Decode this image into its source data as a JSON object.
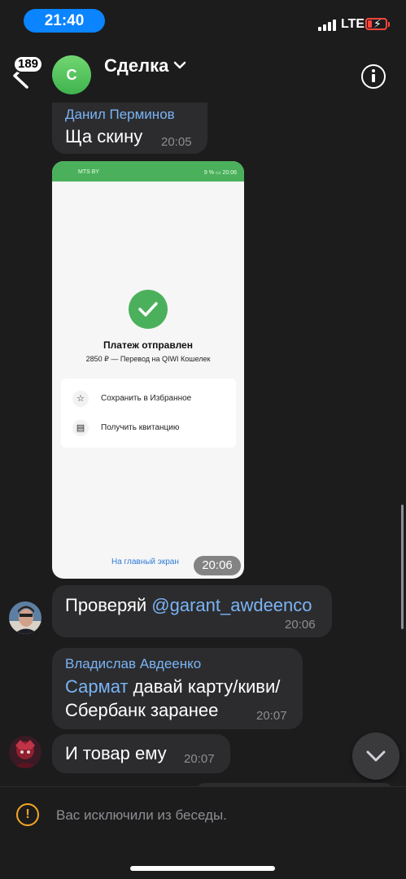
{
  "status_bar": {
    "time": "21:40",
    "network": "LTE",
    "battery_state": "low, charging",
    "battery_color": "#ff453a"
  },
  "header": {
    "back_icon": "chevron-left-icon",
    "unread_count": "189",
    "avatar_letter": "С",
    "avatar_color": "#4cbf56",
    "title": "Сделка",
    "title_icon": "chevron-down-icon",
    "info_icon": "info-icon"
  },
  "messages": [
    {
      "sender": "Данил Перминов",
      "text": "Ща скину",
      "time": "20:05"
    },
    {
      "type": "photo",
      "time": "20:06",
      "screenshot": {
        "operator": "MTS BY",
        "battery": "9 %",
        "clock": "20:06",
        "title": "Платеж отправлен",
        "subtitle": "2850 ₽ — Перевод на QIWI Кошелек",
        "action_save": "Сохранить в Избранное",
        "action_receipt": "Получить квитанцию",
        "home_link": "На главный экран"
      }
    },
    {
      "text": "Проверяй ",
      "mention": "@garant_awdeenco",
      "time": "20:06"
    },
    {
      "sender": "Владислав Авдеенко",
      "mention": "Сармат",
      "text_line1": " давай карту/киви/",
      "text_line2": "Сбербанк заранее",
      "time": "20:07"
    },
    {
      "text": "И товар ему",
      "time": "20:07"
    }
  ],
  "notice": {
    "icon": "warning-icon",
    "text": "Вас исключили из беседы."
  },
  "colors": {
    "background": "#1c1c1d",
    "bubble": "#2c2c2e",
    "link": "#7ab4f5",
    "accent": "#0a84ff",
    "warning": "#f5a623",
    "success": "#4bb05b"
  }
}
